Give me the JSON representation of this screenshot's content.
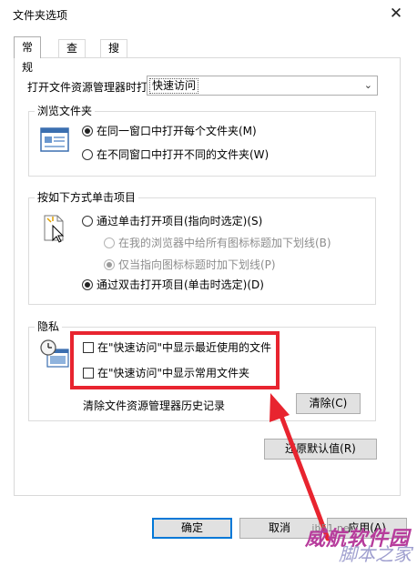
{
  "window": {
    "title": "文件夹选项",
    "close_glyph": "✕"
  },
  "tabs": [
    {
      "label": "常规",
      "active": true
    },
    {
      "label": "查看",
      "active": false
    },
    {
      "label": "搜索",
      "active": false
    }
  ],
  "open_explorer": {
    "label": "打开文件资源管理器时打",
    "selected": "快速访问"
  },
  "browse": {
    "title": "浏览文件夹",
    "options": [
      {
        "label": "在同一窗口中打开每个文件夹(M)",
        "checked": true
      },
      {
        "label": "在不同窗口中打开不同的文件夹(W)",
        "checked": false
      }
    ]
  },
  "click": {
    "title": "按如下方式单击项目",
    "options": [
      {
        "label": "通过单击打开项目(指向时选定)(S)",
        "checked": false,
        "disabled": false
      },
      {
        "label": "在我的浏览器中给所有图标标题加下划线(B)",
        "checked": false,
        "disabled": true
      },
      {
        "label": "仅当指向图标标题时加下划线(P)",
        "checked": true,
        "disabled": true
      },
      {
        "label": "通过双击打开项目(单击时选定)(D)",
        "checked": true,
        "disabled": false
      }
    ]
  },
  "privacy": {
    "title": "隐私",
    "checks": [
      {
        "label": "在\"快速访问\"中显示最近使用的文件",
        "checked": false
      },
      {
        "label": "在\"快速访问\"中显示常用文件夹",
        "checked": false
      }
    ],
    "clear_label": "清除文件资源管理器历史记录",
    "clear_button": "清除(C)"
  },
  "restore_button": "还原默认值(R)",
  "footer": {
    "ok": "确定",
    "cancel": "取消",
    "apply": "应用(A)"
  },
  "watermark": {
    "brand": "威航软件园",
    "site": "脚本之家",
    "domain": "jb51.net"
  },
  "colors": {
    "highlight_box": "#e8242f",
    "default_button_border": "#0078d7"
  }
}
